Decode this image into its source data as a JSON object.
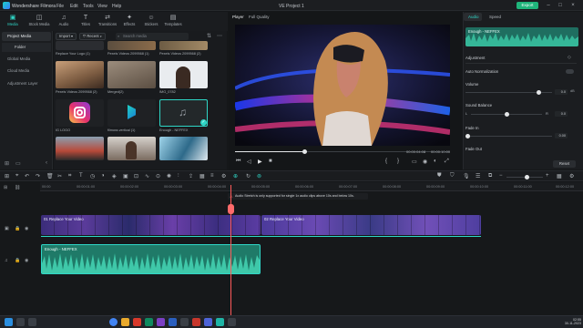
{
  "app": {
    "name": "Wondershare Filmora",
    "project_title": "VE Project 1",
    "export_label": "Export"
  },
  "menu": [
    "File",
    "Edit",
    "Tools",
    "View",
    "Help"
  ],
  "toolbar": [
    {
      "icon": "media-icon",
      "label": "Media"
    },
    {
      "icon": "stock-media-icon",
      "label": "Stock Media"
    },
    {
      "icon": "audio-icon",
      "label": "Audio"
    },
    {
      "icon": "titles-icon",
      "label": "Titles"
    },
    {
      "icon": "transitions-icon",
      "label": "Transitions"
    },
    {
      "icon": "effects-icon",
      "label": "Effects"
    },
    {
      "icon": "stickers-icon",
      "label": "Stickers"
    },
    {
      "icon": "templates-icon",
      "label": "Templates"
    }
  ],
  "sidebar": {
    "project_media": "Project Media",
    "folder": "Folder",
    "items": [
      "Global Media",
      "Cloud Media",
      "Adjustment Layer"
    ]
  },
  "media": {
    "import_label": "Import",
    "recent_label": "Recent",
    "search_placeholder": "Search media",
    "items": [
      {
        "label": "Replace Your Logo (1)"
      },
      {
        "label": "Pexels Videos 2099568 (1)"
      },
      {
        "label": "Pexels Videos 2099568 (2)"
      },
      {
        "label": "Pexels Videos 2099568 (2)"
      },
      {
        "label": "Merged(2)"
      },
      {
        "label": "IMG_0782"
      },
      {
        "label": "IG LOGO"
      },
      {
        "label": "filmora-vertical (1)"
      },
      {
        "label": "Enough - NEFFEX"
      },
      {
        "label": ""
      },
      {
        "label": ""
      },
      {
        "label": ""
      }
    ]
  },
  "player": {
    "tabs": [
      "Player",
      "Full Quality"
    ],
    "current_time": "00:00:04:08",
    "total_time": "00:00:10:00",
    "progress": 0.32
  },
  "props": {
    "tabs": [
      "Audio",
      "Speed"
    ],
    "clip_name": "Enough - NEFFEX",
    "adjustment": "Adjustment",
    "auto_normalization": "Auto Normalization",
    "volume": "Volume",
    "volume_value": "0.0",
    "volume_unit": "dB",
    "sound_balance": "Sound Balance",
    "balance_l": "L",
    "balance_r": "R",
    "balance_value": "0.0",
    "fade_in": "Fade In",
    "fade_in_value": "0.00",
    "fade_out": "Fade Out",
    "reset_label": "Reset"
  },
  "timeline": {
    "ruler": [
      "00:00",
      "00:00:01:00",
      "00:00:02:00",
      "00:00:03:00",
      "00:00:04:00",
      "00:00:05:00",
      "00:00:06:00",
      "00:00:07:00",
      "00:00:08:00",
      "00:00:09:00",
      "00:00:10:00",
      "00:00:11:00",
      "00:00:12:00"
    ],
    "notice": "Audio Stretch is only supported for single 1x audio clips above 10s and below 10s.",
    "clip1": "01 Replace Your Video",
    "clip2": "02 Replace Your Video",
    "audio_clip": "Enough - NEFFEX",
    "playhead_fraction": 0.353
  },
  "taskbar": {
    "time": "02:55",
    "date": "30-11-2023"
  }
}
